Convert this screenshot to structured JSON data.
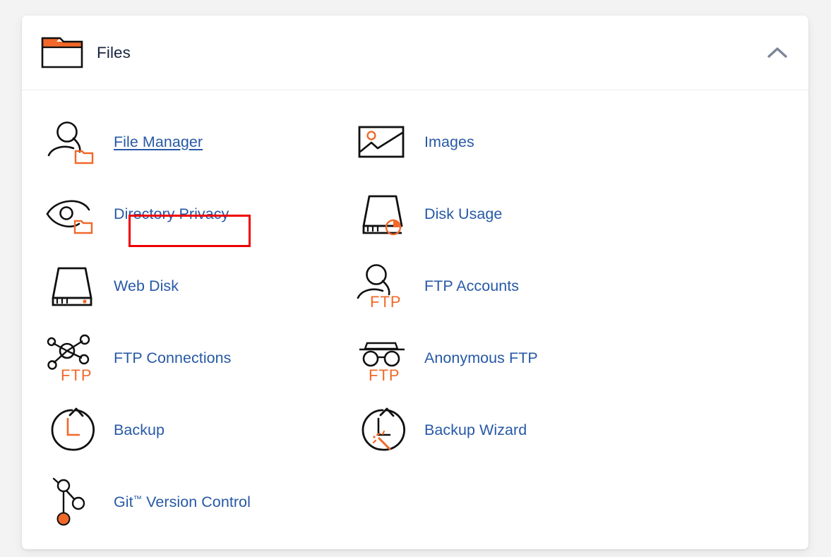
{
  "page": {
    "background_color": "#f3f3f4",
    "card_background": "#ffffff"
  },
  "colors": {
    "link_blue": "#2759a6",
    "title_navy": "#17243f",
    "accent_orange": "#f1682a",
    "icon_outline": "#101010",
    "highlight_red": "#ee0000",
    "chevron_grey": "#7c8799",
    "divider": "#eceef0"
  },
  "header": {
    "icon": "folder-icon",
    "title": "Files",
    "collapse_icon": "chevron-up-icon",
    "collapse_state": "expanded"
  },
  "items": [
    {
      "id": "file-manager",
      "label": "File Manager",
      "icon": "user-folder-icon",
      "highlighted": true,
      "underlined": true
    },
    {
      "id": "images",
      "label": "Images",
      "icon": "picture-icon",
      "highlighted": false,
      "underlined": false
    },
    {
      "id": "directory-privacy",
      "label": "Directory Privacy",
      "icon": "eye-folder-icon",
      "highlighted": false,
      "underlined": false
    },
    {
      "id": "disk-usage",
      "label": "Disk Usage",
      "icon": "disk-pie-icon",
      "highlighted": false,
      "underlined": false
    },
    {
      "id": "web-disk",
      "label": "Web Disk",
      "icon": "disk-icon",
      "highlighted": false,
      "underlined": false
    },
    {
      "id": "ftp-accounts",
      "label": "FTP Accounts",
      "icon": "user-ftp-icon",
      "highlighted": false,
      "underlined": false
    },
    {
      "id": "ftp-connections",
      "label": "FTP Connections",
      "icon": "network-ftp-icon",
      "highlighted": false,
      "underlined": false
    },
    {
      "id": "anonymous-ftp",
      "label": "Anonymous FTP",
      "icon": "disguise-ftp-icon",
      "highlighted": false,
      "underlined": false
    },
    {
      "id": "backup",
      "label": "Backup",
      "icon": "restore-clock-icon",
      "highlighted": false,
      "underlined": false
    },
    {
      "id": "backup-wizard",
      "label": "Backup Wizard",
      "icon": "restore-wand-icon",
      "highlighted": false,
      "underlined": false
    },
    {
      "id": "git-version-control",
      "label_prefix": "Git",
      "label_tm": "™",
      "label_suffix": " Version Control",
      "label": "Git™ Version Control",
      "icon": "git-branch-icon",
      "highlighted": false,
      "underlined": false
    }
  ],
  "ftp_badge_text": "FTP"
}
